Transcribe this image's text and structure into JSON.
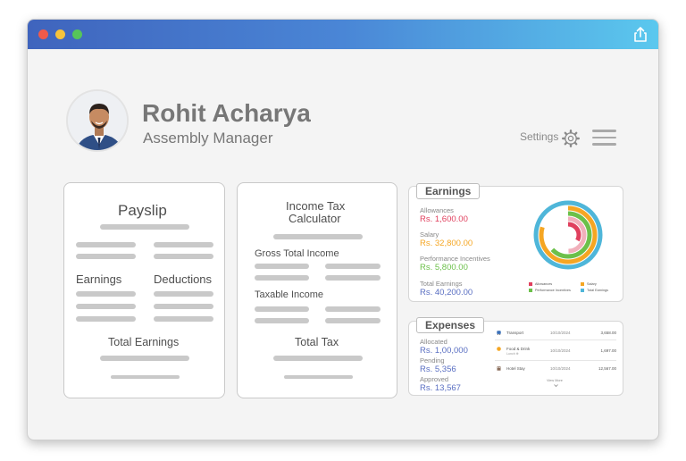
{
  "profile": {
    "name": "Rohit Acharya",
    "role": "Assembly Manager"
  },
  "header": {
    "settings_label": "Settings"
  },
  "payslip": {
    "title": "Payslip",
    "earnings_label": "Earnings",
    "deductions_label": "Deductions",
    "total_label": "Total Earnings"
  },
  "tax_calculator": {
    "title_line1": "Income Tax",
    "title_line2": "Calculator",
    "gross_label": "Gross Total Income",
    "taxable_label": "Taxable Income",
    "total_tax_label": "Total Tax"
  },
  "earnings": {
    "title": "Earnings",
    "items": [
      {
        "label": "Allowances",
        "value": "Rs. 1,600.00",
        "color": "#e0405e"
      },
      {
        "label": "Salary",
        "value": "Rs. 32,800.00",
        "color": "#f5a623"
      },
      {
        "label": "Performance Incentives",
        "value": "Rs. 5,800.00",
        "color": "#6cc04a"
      },
      {
        "label": "Total Earnings",
        "value": "Rs. 40,200.00",
        "color": "#5a6fc2"
      }
    ],
    "legend": [
      {
        "label": "Allowances",
        "color": "#e0405e"
      },
      {
        "label": "Salary",
        "color": "#f5a623"
      },
      {
        "label": "Performance Incentives",
        "color": "#6cc04a"
      },
      {
        "label": "Total Earnings",
        "color": "#4fb6d9"
      }
    ]
  },
  "expenses": {
    "title": "Expenses",
    "allocated_label": "Allocated",
    "allocated_value": "Rs. 1,00,000",
    "pending_label": "Pending",
    "pending_value": "Rs. 5,356",
    "approved_label": "Approved",
    "approved_value": "Rs. 13,567",
    "rows": [
      {
        "icon": "transport-icon",
        "title": "Transport",
        "sub": "",
        "date": "10/10/2024",
        "amount": "3,658.00"
      },
      {
        "icon": "food-icon",
        "title": "Food & Drink",
        "sub": "Lunch ⊕",
        "date": "10/10/2024",
        "amount": "1,697.00"
      },
      {
        "icon": "hotel-icon",
        "title": "Hotel Stay",
        "sub": "",
        "date": "10/10/2024",
        "amount": "12,567.00"
      }
    ],
    "view_more": "View More"
  }
}
